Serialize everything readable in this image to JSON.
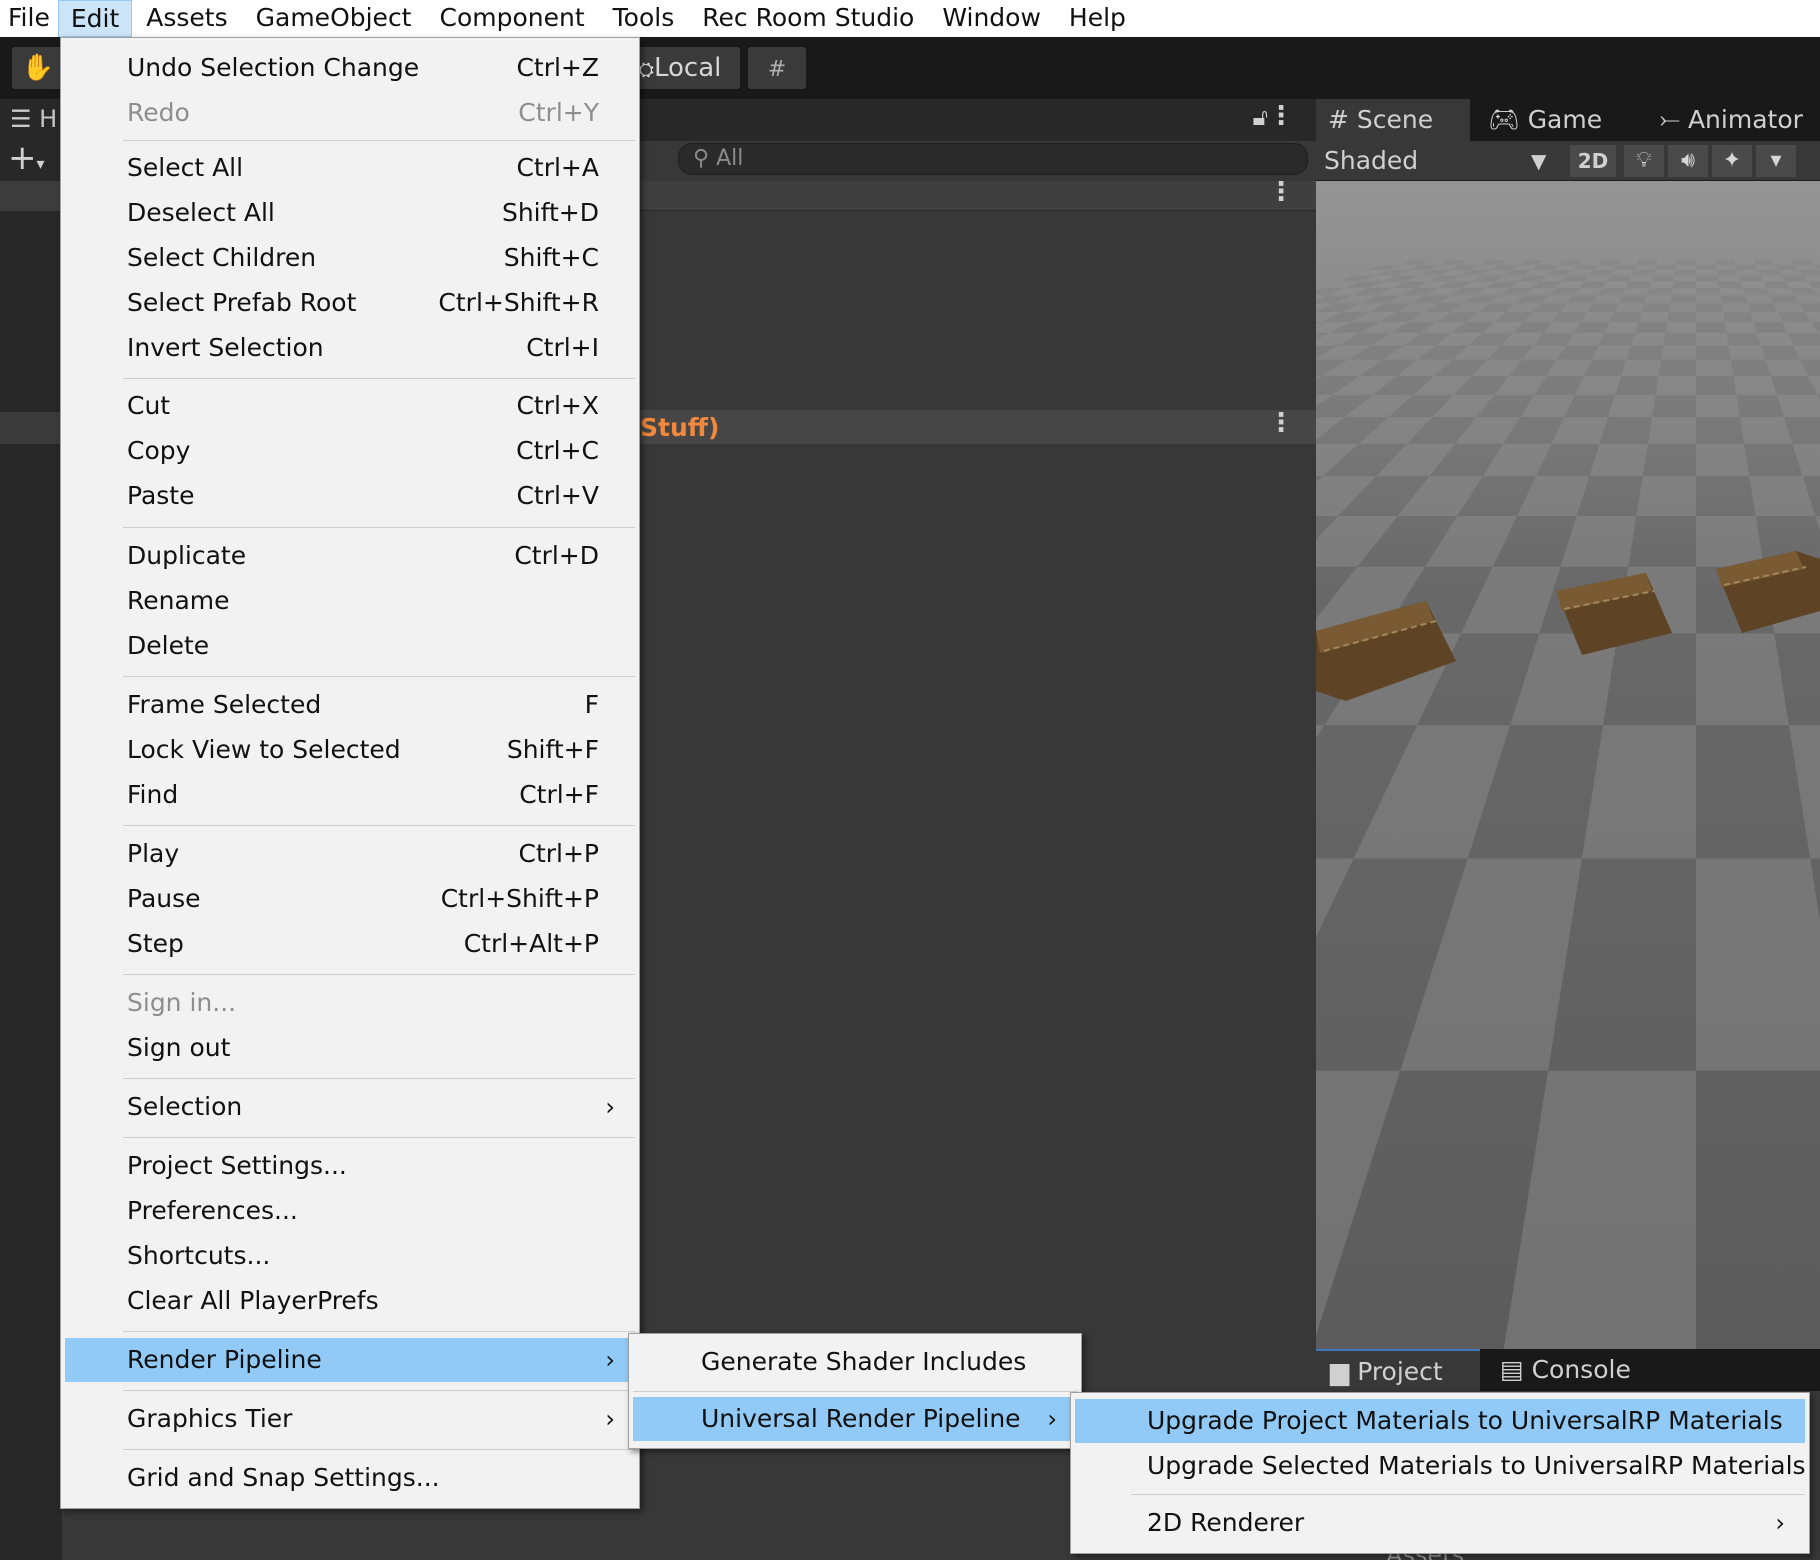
{
  "menubar": {
    "items": [
      "File",
      "Edit",
      "Assets",
      "GameObject",
      "Component",
      "Tools",
      "Rec Room Studio",
      "Window",
      "Help"
    ]
  },
  "toolbar": {
    "pivot_label": "Local"
  },
  "hierarchy": {
    "tab_label": "H"
  },
  "center_panel": {
    "search_placeholder": "All",
    "highlight_text": "Stuff)"
  },
  "scene": {
    "tabs": [
      "Scene",
      "Game",
      "Animator"
    ],
    "shading_mode": "Shaded",
    "mode_2d": "2D"
  },
  "bottom": {
    "tabs": [
      "Project",
      "Console"
    ],
    "assets_label": "Assets"
  },
  "edit_menu": {
    "items": [
      {
        "label": "Undo Selection Change",
        "shortcut": "Ctrl+Z"
      },
      {
        "label": "Redo",
        "shortcut": "Ctrl+Y"
      },
      {
        "label": "Select All",
        "shortcut": "Ctrl+A"
      },
      {
        "label": "Deselect All",
        "shortcut": "Shift+D"
      },
      {
        "label": "Select Children",
        "shortcut": "Shift+C"
      },
      {
        "label": "Select Prefab Root",
        "shortcut": "Ctrl+Shift+R"
      },
      {
        "label": "Invert Selection",
        "shortcut": "Ctrl+I"
      },
      {
        "label": "Cut",
        "shortcut": "Ctrl+X"
      },
      {
        "label": "Copy",
        "shortcut": "Ctrl+C"
      },
      {
        "label": "Paste",
        "shortcut": "Ctrl+V"
      },
      {
        "label": "Duplicate",
        "shortcut": "Ctrl+D"
      },
      {
        "label": "Rename",
        "shortcut": ""
      },
      {
        "label": "Delete",
        "shortcut": ""
      },
      {
        "label": "Frame Selected",
        "shortcut": "F"
      },
      {
        "label": "Lock View to Selected",
        "shortcut": "Shift+F"
      },
      {
        "label": "Find",
        "shortcut": "Ctrl+F"
      },
      {
        "label": "Play",
        "shortcut": "Ctrl+P"
      },
      {
        "label": "Pause",
        "shortcut": "Ctrl+Shift+P"
      },
      {
        "label": "Step",
        "shortcut": "Ctrl+Alt+P"
      },
      {
        "label": "Sign in...",
        "shortcut": ""
      },
      {
        "label": "Sign out",
        "shortcut": ""
      },
      {
        "label": "Selection",
        "shortcut": ""
      },
      {
        "label": "Project Settings...",
        "shortcut": ""
      },
      {
        "label": "Preferences...",
        "shortcut": ""
      },
      {
        "label": "Shortcuts...",
        "shortcut": ""
      },
      {
        "label": "Clear All PlayerPrefs",
        "shortcut": ""
      },
      {
        "label": "Render Pipeline",
        "shortcut": ""
      },
      {
        "label": "Graphics Tier",
        "shortcut": ""
      },
      {
        "label": "Grid and Snap Settings...",
        "shortcut": ""
      }
    ]
  },
  "render_pipeline_menu": {
    "items": [
      {
        "label": "Generate Shader Includes"
      },
      {
        "label": "Universal Render Pipeline"
      }
    ]
  },
  "urp_menu": {
    "items": [
      {
        "label": "Upgrade Project Materials to UniversalRP Materials"
      },
      {
        "label": "Upgrade Selected Materials to UniversalRP Materials"
      },
      {
        "label": "2D Renderer"
      }
    ]
  },
  "colors": {
    "menu_highlight": "#91c9f7",
    "menu_background": "#f2f2f2",
    "editor_dark": "#383838",
    "accent_orange": "#f0883e"
  }
}
